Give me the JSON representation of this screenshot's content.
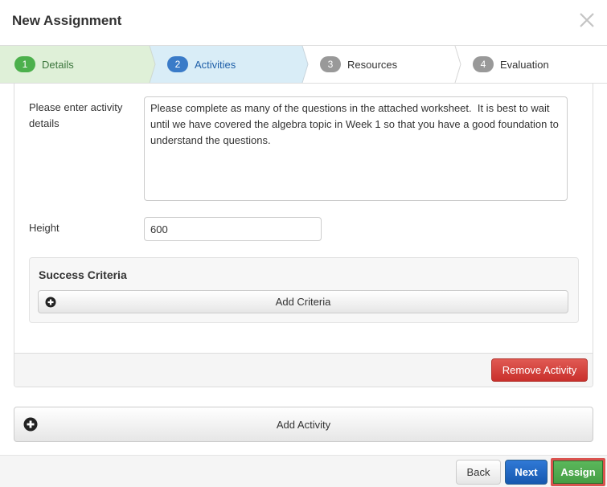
{
  "modal": {
    "title": "New Assignment",
    "close_icon": "close-icon"
  },
  "wizard": {
    "steps": [
      {
        "number": "1",
        "label": "Details",
        "state": "complete",
        "bg": "#dff0d8",
        "badge_color": "#4cb04c",
        "text_color": "#3c763d"
      },
      {
        "number": "2",
        "label": "Activities",
        "state": "active",
        "bg": "#d9edf7",
        "badge_color": "#3a7bc8",
        "text_color": "#1f5fa8"
      },
      {
        "number": "3",
        "label": "Resources",
        "state": "pending",
        "bg": "#ffffff",
        "badge_color": "#999999",
        "text_color": "#333333"
      },
      {
        "number": "4",
        "label": "Evaluation",
        "state": "pending",
        "bg": "#ffffff",
        "badge_color": "#999999",
        "text_color": "#333333"
      }
    ]
  },
  "activity": {
    "details_label": "Please enter activity details",
    "details_value": "Please complete as many of the questions in the attached worksheet.  It is best to wait until we have covered the algebra topic in Week 1 so that you have a good foundation to understand the questions.",
    "height_label": "Height",
    "height_value": "600",
    "success_criteria": {
      "title": "Success Criteria",
      "add_button": "Add Criteria",
      "add_icon": "plus-circle-icon"
    },
    "remove_button": "Remove Activity"
  },
  "add_activity": {
    "label": "Add Activity",
    "icon": "plus-circle-icon"
  },
  "footer": {
    "back": "Back",
    "next": "Next",
    "assign": "Assign"
  }
}
